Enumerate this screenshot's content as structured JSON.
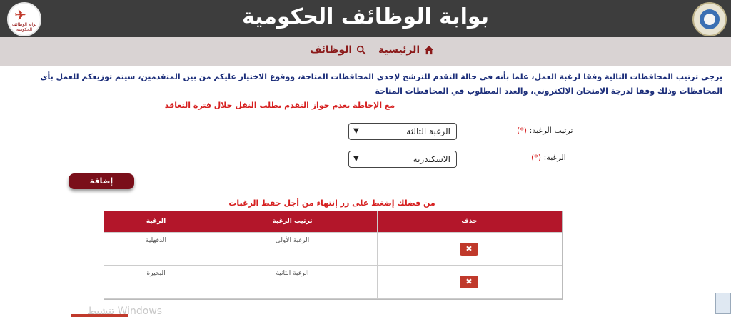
{
  "header": {
    "title": "بوابة الوظائف الحكومية",
    "logo_left_text": "بوابة الوظائف الحكومية"
  },
  "nav": {
    "home_label": "الرئيسية",
    "jobs_label": "الوظائف"
  },
  "instructions": {
    "line1": "يرجى ترتيب المحافظات التالية وفقا لرغبة العمل، علما بأنه في حالة التقدم للترشح لإحدى المحافظات المتاحة، ووقوع الاختيار عليكم من بين المتقدمين، سيتم توزيعكم للعمل بأي",
    "line2": "المحافظات وذلك وفقا لدرجة الامتحان الالكتروني، والعدد المطلوب في المحافظات المتاحة",
    "warning": "مع الإحاطة بعدم جواز التقدم بطلب النقل خلال فترة التعاقد"
  },
  "form": {
    "rank_label": "ترتيب الرغبة:",
    "rank_required": "(*)",
    "rank_value": "الرغبة الثالثة",
    "wish_label": "الرغبة:",
    "wish_required": "(*)",
    "wish_value": "الاسكندرية",
    "add_label": "إضافة"
  },
  "notice": "من فضلك إضغط على زر إنتهاء من أجل حفظ الرغبات",
  "table": {
    "headers": {
      "delete": "حذف",
      "rank": "ترتيب الرغبة",
      "wish": "الرغبة"
    },
    "rows": [
      {
        "rank": "الرغبة الأولى",
        "wish": "الدقهلية"
      },
      {
        "rank": "الرغبة الثانية",
        "wish": "البحيرة"
      }
    ],
    "delete_symbol": "✖"
  },
  "watermark": "تنشيط Windows",
  "colors": {
    "header_bg": "#3d3d3d",
    "nav_bg": "#d9d3d3",
    "accent": "#b3162a",
    "instruction_text": "#1c2e7a",
    "warning_text": "#d62020"
  }
}
